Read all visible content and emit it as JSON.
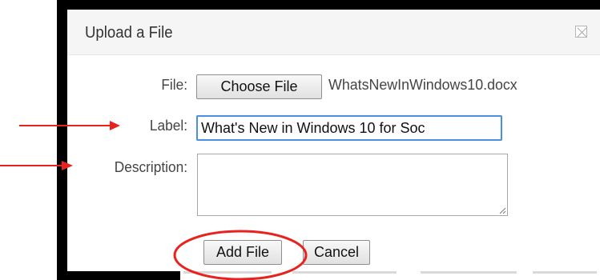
{
  "dialog": {
    "title": "Upload a File",
    "close_icon": "close-icon"
  },
  "form": {
    "file_label": "File:",
    "choose_file_label": "Choose File",
    "chosen_file_name": "WhatsNewInWindows10.docx",
    "label_label": "Label:",
    "label_value": "What's New in Windows 10 for Soc",
    "description_label": "Description:",
    "description_value": ""
  },
  "actions": {
    "add_file_label": "Add File",
    "cancel_label": "Cancel"
  },
  "annotations": {
    "arrow_color": "#e8231f",
    "circle_color": "#e8231f"
  }
}
